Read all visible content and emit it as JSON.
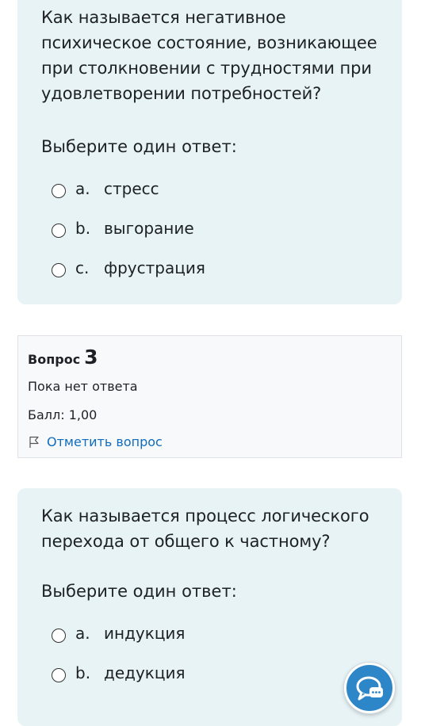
{
  "question2": {
    "text": "Как называется негативное психическое состояние, возникающее при столкновении с трудностями при удовлетворении потребностей?",
    "prompt": "Выберите один ответ:",
    "answers": [
      {
        "letter": "a.",
        "text": "стресс"
      },
      {
        "letter": "b.",
        "text": "выгорание"
      },
      {
        "letter": "c.",
        "text": "фрустрация"
      }
    ]
  },
  "question3_info": {
    "label": "Вопрос",
    "number": "3",
    "state": "Пока нет ответа",
    "grade": "Балл: 1,00",
    "flag_text": "Отметить вопрос",
    "flag_icon": "flag-icon"
  },
  "question3": {
    "text": "Как называется процесс логического перехода от общего к частному?",
    "prompt": "Выберите один ответ:",
    "answers": [
      {
        "letter": "a.",
        "text": "индукция"
      },
      {
        "letter": "b.",
        "text": "дедукция"
      }
    ]
  },
  "chat_widget": {
    "icon": "chat-bubble-icon"
  },
  "colors": {
    "card_bg": "#e7f3f5",
    "info_bg": "#f8f9fa",
    "link": "#0f6cbf",
    "chat_bg": "#2d86c8"
  }
}
